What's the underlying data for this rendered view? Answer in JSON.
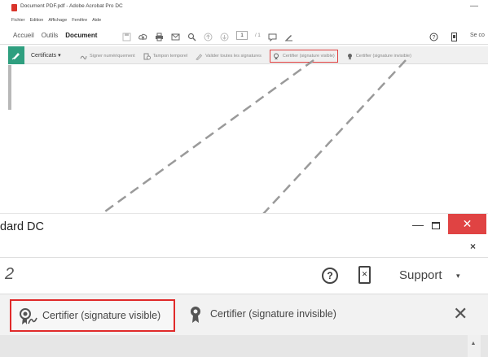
{
  "top": {
    "window_title": "Document PDF.pdf - Adobe Acrobat Pro DC",
    "minimize_glyph": "—",
    "menu": [
      "Fichier",
      "Edition",
      "Affichage",
      "Fenêtre",
      "Aide"
    ],
    "tabs": [
      "Accueil",
      "Outils",
      "Document"
    ],
    "active_tab": "Document",
    "page_current": "1",
    "page_total": "/ 1",
    "support_fragment": "Se co",
    "cert_label": "Certificats",
    "cert_items": [
      "Signer numériquement",
      "Tampon temporel",
      "Valider toutes les signatures",
      "Certifier (signature visible)",
      "Certifier (signature invisible)"
    ]
  },
  "zoom": {
    "window_title_fragment": "dard DC",
    "minimize_glyph": "—",
    "close_glyph": "✕",
    "sub_close_glyph": "×",
    "partial_glyph": "2",
    "help_glyph": "?",
    "phone_glyph": "✕",
    "support_label": "Support",
    "support_caret": "▾",
    "cert_visible_label": "Certifier (signature visible)",
    "cert_invisible_label": "Certifier (signature invisible)",
    "bar_close_glyph": "✕",
    "scroll_up_glyph": "▲"
  },
  "colors": {
    "highlight": "#e02a2a",
    "cert_badge": "#2f9f7f",
    "window_close": "#e04343"
  }
}
